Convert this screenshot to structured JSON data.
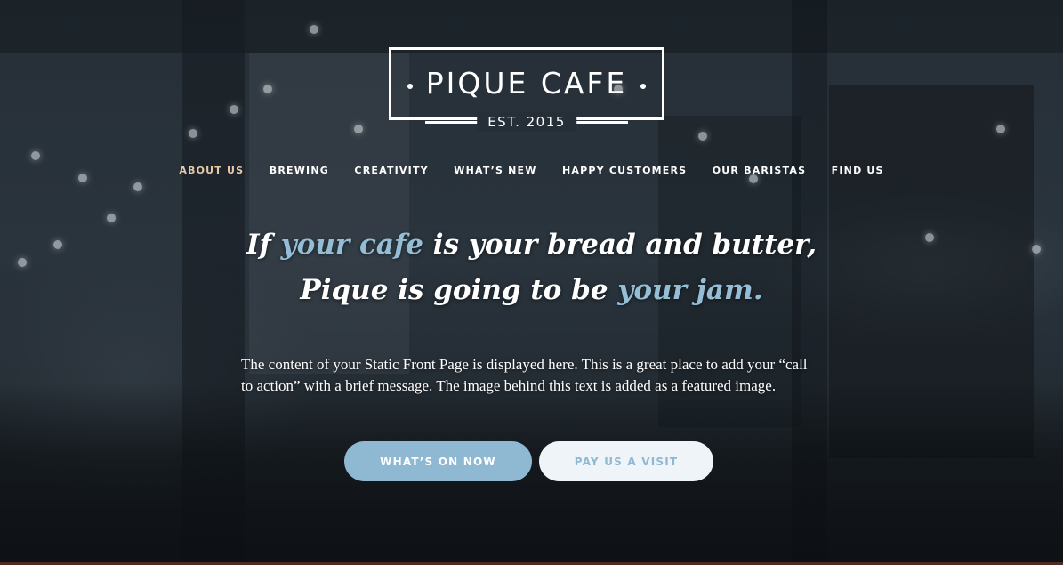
{
  "brand": {
    "name": "PIQUE CAFE",
    "est": "EST. 2015"
  },
  "nav": {
    "items": [
      {
        "label": "ABOUT US",
        "active": true
      },
      {
        "label": "BREWING"
      },
      {
        "label": "CREATIVITY"
      },
      {
        "label": "WHAT’S NEW"
      },
      {
        "label": "HAPPY CUSTOMERS"
      },
      {
        "label": "OUR BARISTAS"
      },
      {
        "label": "FIND US"
      }
    ]
  },
  "hero": {
    "line1": {
      "a": "If ",
      "b": "your cafe",
      "c": " is your bread and butter,"
    },
    "line2": {
      "a": "Pique is going to be ",
      "b": "your jam."
    },
    "body": "The content of your Static Front Page is displayed here. This is a great place to add your “call to action” with a brief message. The image behind this text is added as a featured image."
  },
  "buttons": {
    "primary": "WHAT’S ON NOW",
    "secondary": "PAY US A VISIT"
  },
  "colors": {
    "accent": "#94bdd6",
    "nav_active": "#e8c9a7",
    "primary_button": "#8fb8d2",
    "secondary_button": "#eef4f8"
  }
}
